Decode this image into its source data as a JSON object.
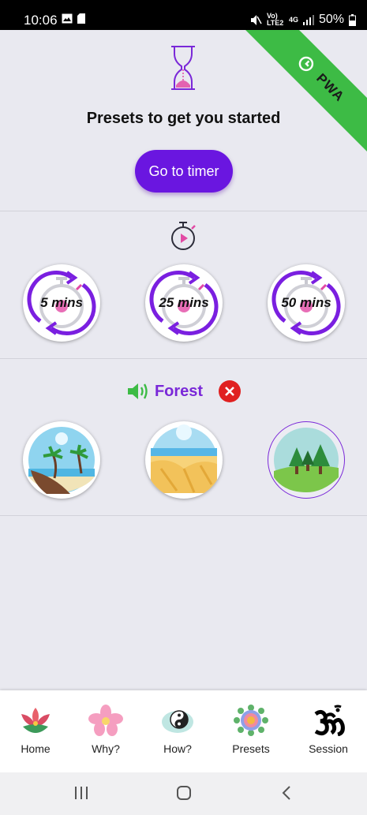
{
  "status_bar": {
    "time": "10:06",
    "volte": "Vo) LTE2",
    "network": "4G",
    "battery": "50%"
  },
  "ribbon": {
    "label": "PWA"
  },
  "header": {
    "title": "Presets to get you started",
    "goto_button": "Go to timer"
  },
  "timer_presets": [
    {
      "label": "5 mins"
    },
    {
      "label": "25 mins"
    },
    {
      "label": "50 mins"
    }
  ],
  "sound": {
    "selected_name": "Forest",
    "scenes": [
      "beach-scene",
      "desert-scene",
      "forest-scene"
    ]
  },
  "bottom_nav": {
    "items": [
      {
        "label": "Home",
        "icon": "lotus-icon"
      },
      {
        "label": "Why?",
        "icon": "flower-icon"
      },
      {
        "label": "How?",
        "icon": "yin-yang-icon"
      },
      {
        "label": "Presets",
        "icon": "mandala-icon"
      },
      {
        "label": "Session",
        "icon": "om-icon"
      }
    ]
  },
  "colors": {
    "accent": "#6a16e0",
    "ribbon": "#3dbb45",
    "sound_icon": "#3dbb45",
    "close": "#e02020"
  }
}
